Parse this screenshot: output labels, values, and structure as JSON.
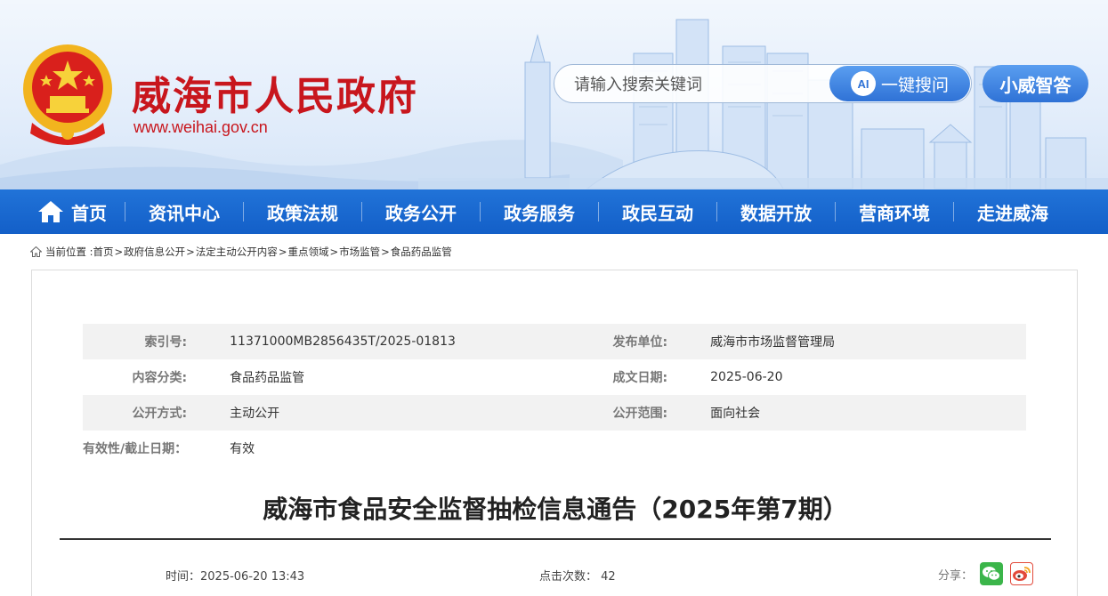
{
  "header": {
    "site_title": "威海市人民政府",
    "site_url": "www.weihai.gov.cn",
    "search_placeholder": "请输入搜索关键词",
    "search_ai_badge": "AI",
    "search_button": "一键搜问",
    "assistant_button": "小威智答",
    "colors": {
      "title_red": "#c8161d",
      "accent_blue": "#2f72d6"
    }
  },
  "nav": {
    "items": [
      "首页",
      "资讯中心",
      "政策法规",
      "政务公开",
      "政务服务",
      "政民互动",
      "数据开放",
      "营商环境",
      "走进威海"
    ]
  },
  "breadcrumb": {
    "prefix": "当前位置 :",
    "items": [
      "首页",
      "政府信息公开",
      "法定主动公开内容",
      "重点领域",
      "市场监管",
      "食品药品监管"
    ]
  },
  "meta": {
    "index_no_label": "索引号:",
    "index_no": "11371000MB2856435T/2025-01813",
    "publisher_label": "发布单位:",
    "publisher": "威海市市场监督管理局",
    "category_label": "内容分类:",
    "category": "食品药品监管",
    "created_label": "成文日期:",
    "created": "2025-06-20",
    "method_label": "公开方式:",
    "method": "主动公开",
    "scope_label": "公开范围:",
    "scope": "面向社会",
    "validity_label": "有效性/截止日期：",
    "validity": "有效"
  },
  "article": {
    "title": "威海市食品安全监督抽检信息通告（2025年第7期）",
    "time_label": "时间：",
    "time": "2025-06-20 13:43",
    "clicks_label": "点击次数：",
    "clicks": "42",
    "share_label": "分享："
  }
}
